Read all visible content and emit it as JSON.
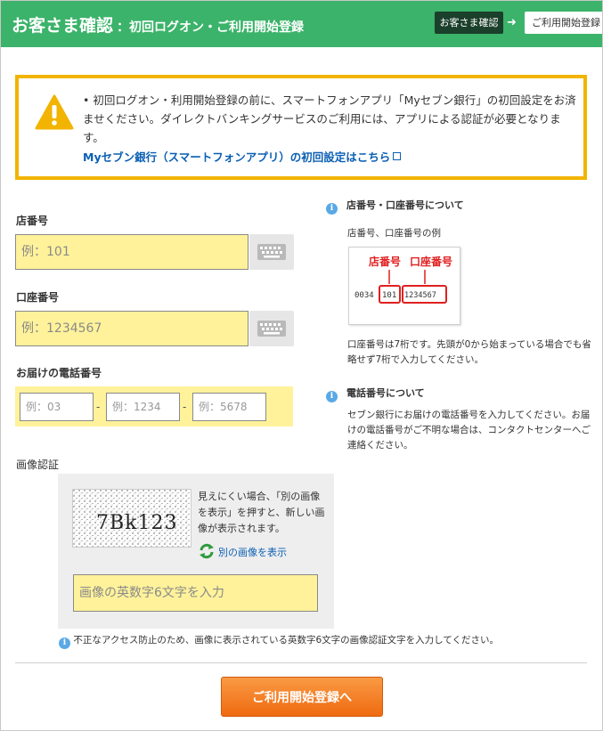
{
  "header": {
    "title": "お客さま確認",
    "subtitle": "：初回ログオン・ご利用開始登録",
    "step_current": "お客さま確認",
    "step_next": "ご利用開始登録"
  },
  "notice": {
    "text": "• 初回ログオン・利用開始登録の前に、スマートフォンアプリ「Myセブン銀行」の初回設定をお済ませください。ダイレクトバンキングサービスのご利用には、アプリによる認証が必要となります。",
    "link": "Myセブン銀行（スマートフォンアプリ）の初回設定はこちら"
  },
  "form": {
    "branch_label": "店番号",
    "branch_placeholder": "例：101",
    "account_label": "口座番号",
    "account_placeholder": "例：1234567",
    "phone_label": "お届けの電話番号",
    "phone_placeholders": [
      "例：03",
      "例：1234",
      "例：5678"
    ],
    "phone_separator": "-",
    "captcha_label": "画像認証",
    "captcha_text": "7Bk123",
    "captcha_help": "見えにくい場合、「別の画像を表示」を押すと、新しい画像が表示されます。",
    "captcha_reload": "別の画像を表示",
    "captcha_placeholder": "画像の英数字6文字を入力",
    "captcha_note": "不正なアクセス防止のため、画像に表示されている英数字6文字の画像認証文字を入力してください。",
    "submit": "ご利用開始登録へ"
  },
  "side": {
    "number_heading": "店番号・口座番号について",
    "number_example_caption": "店番号、口座番号の例",
    "example_branch_label": "店番号",
    "example_account_label": "口座番号",
    "example_prefix": "0034",
    "example_branch": "101",
    "example_account": "1234567",
    "number_note": "口座番号は7桁です。先頭が0から始まっている場合でも省略せず7桁で入力してください。",
    "phone_heading": "電話番号について",
    "phone_note": "セブン銀行にお届けの電話番号を入力してください。お届けの電話番号がご不明な場合は、コンタクトセンターへご連絡ください。"
  },
  "colors": {
    "header_green": "#3bb36a",
    "warning_yellow": "#f2b400",
    "field_yellow": "#fff29a",
    "link_blue": "#0b5fb3",
    "submit_orange": "#f07a1e",
    "example_red": "#e02020"
  }
}
